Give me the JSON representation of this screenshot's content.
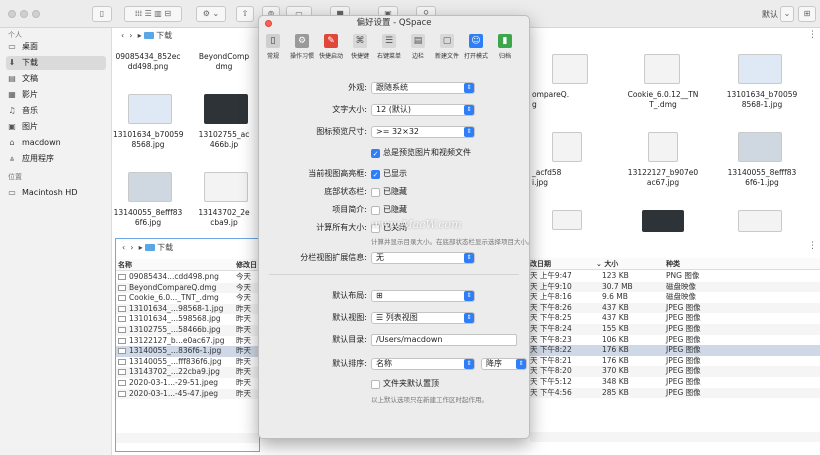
{
  "toolbar": {
    "search_icon": "search-icon",
    "right_label": "默认"
  },
  "sidebar": {
    "section1": "个人",
    "items": [
      {
        "label": "桌面",
        "icon": "desktop-icon"
      },
      {
        "label": "下载",
        "icon": "download-icon"
      },
      {
        "label": "文稿",
        "icon": "document-icon"
      },
      {
        "label": "影片",
        "icon": "film-icon"
      },
      {
        "label": "音乐",
        "icon": "music-icon"
      },
      {
        "label": "图片",
        "icon": "photo-icon"
      },
      {
        "label": "macdown",
        "icon": "home-icon"
      },
      {
        "label": "应用程序",
        "icon": "apps-icon"
      }
    ],
    "section2": "位置",
    "device": "Macintosh HD"
  },
  "top_left_pane": {
    "path": "下载",
    "files": [
      {
        "name1": "09085434_852ec",
        "name2": "dd498.png"
      },
      {
        "name1": "BeyondComp",
        "name2": "dmg"
      },
      {
        "name1": "13101634_b70059",
        "name2": "8568.jpg"
      },
      {
        "name1": "13102755_ac",
        "name2": "466b.jp"
      },
      {
        "name1": "13140055_8efff83",
        "name2": "6f6.jpg"
      },
      {
        "name1": "13143702_2e",
        "name2": "cba9.jp"
      }
    ]
  },
  "top_right_pane": {
    "files": [
      {
        "name1": "ompareQ.",
        "name2": "g"
      },
      {
        "name1": "Cookie_6.0.12__TN",
        "name2": "T_.dmg"
      },
      {
        "name1": "13101634_b70059",
        "name2": "8568-1.jpg"
      },
      {
        "name1": "_acfd58",
        "name2": "i.jpg"
      },
      {
        "name1": "13122127_b907e0",
        "name2": "ac67.jpg"
      },
      {
        "name1": "13140055_8efff83",
        "name2": "6f6-1.jpg"
      }
    ]
  },
  "bottom_left_pane": {
    "path": "下载",
    "col_name": "名称",
    "col_date": "修改日",
    "rows": [
      {
        "name": "09085434...cdd498.png",
        "date": "今天"
      },
      {
        "name": "BeyondCompareQ.dmg",
        "date": "今天"
      },
      {
        "name": "Cookie_6.0..._TNT_.dmg",
        "date": "今天"
      },
      {
        "name": "13101634_...98568-1.jpg",
        "date": "昨天"
      },
      {
        "name": "13101634_...598568.jpg",
        "date": "昨天"
      },
      {
        "name": "13102755_...58466b.jpg",
        "date": "昨天"
      },
      {
        "name": "13122127_b...e0ac67.jpg",
        "date": "昨天"
      },
      {
        "name": "13140055_...836f6-1.jpg",
        "date": "昨天"
      },
      {
        "name": "13140055_...fff836f6.jpg",
        "date": "昨天"
      },
      {
        "name": "13143702_...22cba9.jpg",
        "date": "昨天"
      },
      {
        "name": "2020-03-1...-29-51.jpeg",
        "date": "昨天"
      },
      {
        "name": "2020-03-1...-45-47.jpeg",
        "date": "昨天"
      }
    ]
  },
  "bottom_right_pane": {
    "col_date": "改日期",
    "col_size": "大小",
    "col_kind": "种类",
    "rows": [
      {
        "date": "天 上午9:47",
        "size": "123 KB",
        "kind": "PNG 图像"
      },
      {
        "date": "天 上午9:10",
        "size": "30.7 MB",
        "kind": "磁盘映像"
      },
      {
        "date": "天 上午8:16",
        "size": "9.6 MB",
        "kind": "磁盘映像"
      },
      {
        "date": "天 下午8:26",
        "size": "437 KB",
        "kind": "JPEG 图像"
      },
      {
        "date": "天 下午8:25",
        "size": "437 KB",
        "kind": "JPEG 图像"
      },
      {
        "date": "天 下午8:24",
        "size": "155 KB",
        "kind": "JPEG 图像"
      },
      {
        "date": "天 下午8:23",
        "size": "106 KB",
        "kind": "JPEG 图像"
      },
      {
        "date": "天 下午8:22",
        "size": "176 KB",
        "kind": "JPEG 图像"
      },
      {
        "date": "天 下午8:21",
        "size": "176 KB",
        "kind": "JPEG 图像"
      },
      {
        "date": "天 下午8:20",
        "size": "370 KB",
        "kind": "JPEG 图像"
      },
      {
        "date": "天 下午5:12",
        "size": "348 KB",
        "kind": "JPEG 图像"
      },
      {
        "date": "天 下午4:56",
        "size": "285 KB",
        "kind": "JPEG 图像"
      }
    ]
  },
  "dialog": {
    "title": "偏好设置 - QSpace",
    "tabs": [
      {
        "label": "常规",
        "icon": "general-icon",
        "color": "#8e8e8e"
      },
      {
        "label": "操作习惯",
        "icon": "gear-icon",
        "color": "#9a9a9a"
      },
      {
        "label": "快捷启动",
        "icon": "rocket-icon",
        "color": "#e0463a"
      },
      {
        "label": "快捷键",
        "icon": "command-icon",
        "color": "#d8d8d8"
      },
      {
        "label": "右键菜单",
        "icon": "menu-icon",
        "color": "#d8d8d8"
      },
      {
        "label": "边栏",
        "icon": "sidebar-icon",
        "color": "#d8d8d8"
      },
      {
        "label": "新建文件",
        "icon": "new-file-icon",
        "color": "#d8d8d8"
      },
      {
        "label": "打开模式",
        "icon": "finder-icon",
        "color": "#2f7ef7"
      },
      {
        "label": "归档",
        "icon": "archive-icon",
        "color": "#3ea64a"
      }
    ],
    "appearance_label": "外观:",
    "appearance_value": "跟随系统",
    "font_label": "文字大小:",
    "font_value": "12 (默认)",
    "iconsize_label": "图标预览尺寸:",
    "iconsize_value": ">= 32×32",
    "preview_check": "总是预览图片和视频文件",
    "highlight_label": "当前视图高亮框:",
    "highlight_check": "已显示",
    "statusbar_label": "底部状态栏:",
    "statusbar_check": "已隐藏",
    "intro_label": "项目简介:",
    "intro_check": "已隐藏",
    "calcsize_label": "计算所有大小:",
    "calcsize_check": "已关闭",
    "calcsize_hint": "计算并显示目录大小。在底部状态栏显示选择项目大小。",
    "watermark": "www.MacW.com",
    "split_label": "分栏视图扩展信息:",
    "split_value": "无",
    "layout_label": "默认布局:",
    "layout_value": "⊞",
    "view_label": "默认视图:",
    "view_value": "☰ 列表视图",
    "dir_label": "默认目录:",
    "dir_value": "/Users/macdown",
    "sort_label": "默认排序:",
    "sort_value": "名称",
    "sort_order": "降序",
    "folder_top_check": "文件夹默认置顶",
    "folder_hint": "以上默认选项只在新建工作区时起作用。"
  }
}
